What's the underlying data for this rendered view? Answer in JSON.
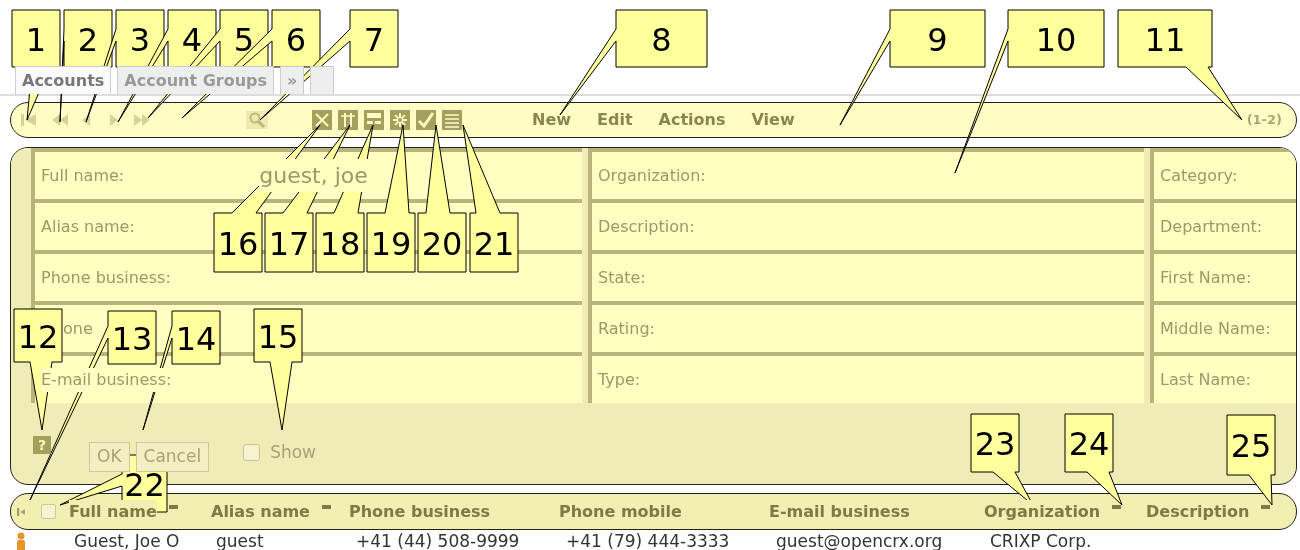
{
  "tabs": [
    {
      "kind": "text",
      "label": "Accounts",
      "selected": true
    },
    {
      "kind": "text",
      "label": "Account Groups",
      "selected": false
    },
    {
      "kind": "text",
      "label": "»",
      "selected": false
    },
    {
      "kind": "empty",
      "selected": false
    }
  ],
  "toolbar": {
    "menu": [
      "New",
      "Edit",
      "Actions",
      "View"
    ],
    "count": "(1-2)"
  },
  "form": {
    "columns": [
      [
        {
          "label": "Full name:",
          "value": "guest, joe"
        },
        {
          "label": "Alias name:"
        },
        {
          "label": "Phone business:"
        },
        {
          "label": "one"
        },
        {
          "label": "E-mail business:"
        }
      ],
      [
        {
          "label": "Organization:"
        },
        {
          "label": "Description:"
        },
        {
          "label": "State:"
        },
        {
          "label": "Rating:"
        },
        {
          "label": "Type:"
        }
      ],
      [
        {
          "label": "Category:"
        },
        {
          "label": "Department:"
        },
        {
          "label": "First Name:"
        },
        {
          "label": "Middle Name:"
        },
        {
          "label": "Last Name:"
        }
      ]
    ],
    "help": "?",
    "buttons": [
      "OK",
      "Cancel"
    ],
    "show": {
      "label": "Show",
      "checked": false
    }
  },
  "grid": {
    "select_all_checked": false,
    "columns": [
      {
        "label": "Full name",
        "sort_mark": true
      },
      {
        "label": "Alias name",
        "sort_mark": true
      },
      {
        "label": "Phone business",
        "sort_mark": false
      },
      {
        "label": "Phone mobile",
        "sort_mark": false
      },
      {
        "label": "E-mail business",
        "sort_mark": false
      },
      {
        "label": "Organization",
        "sort_mark": true
      },
      {
        "label": "Description",
        "sort_mark": true
      }
    ],
    "rows": [
      {
        "cells": [
          "Guest, Joe O",
          "guest",
          "+41 (44) 508-9999",
          "+41 (79) 444-3333",
          "guest@opencrx.org",
          "CRIXP Corp."
        ]
      }
    ]
  },
  "callouts": [
    "1",
    "2",
    "3",
    "4",
    "5",
    "6",
    "7",
    "8",
    "9",
    "10",
    "11",
    "12",
    "13",
    "14",
    "15",
    "16",
    "17",
    "18",
    "19",
    "20",
    "21",
    "22",
    "23",
    "24",
    "25"
  ]
}
